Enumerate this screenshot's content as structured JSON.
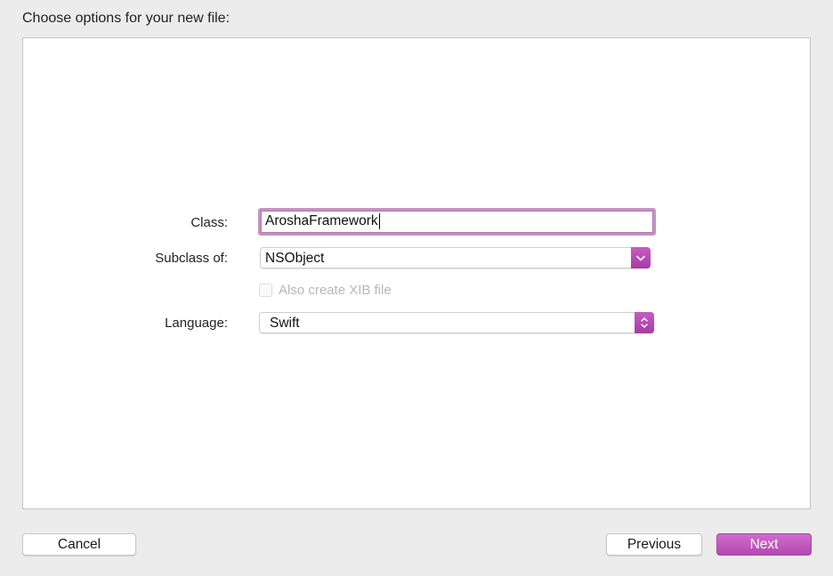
{
  "dialog": {
    "title": "Choose options for your new file:"
  },
  "form": {
    "class_label": "Class:",
    "class_value": "AroshaFramework",
    "subclass_label": "Subclass of:",
    "subclass_value": "NSObject",
    "xib_label": "Also create XIB file",
    "xib_checked": false,
    "xib_enabled": false,
    "language_label": "Language:",
    "language_value": "Swift"
  },
  "buttons": {
    "cancel": "Cancel",
    "previous": "Previous",
    "next": "Next"
  },
  "colors": {
    "accent": "#b548b2",
    "focus_ring": "#c591c3",
    "background": "#ececec",
    "panel": "#ffffff",
    "disabled_text": "#b8b8b8"
  },
  "icons": {
    "subclass_popup": "chevron-down-icon",
    "language_popup": "up-down-chevron-icon"
  }
}
